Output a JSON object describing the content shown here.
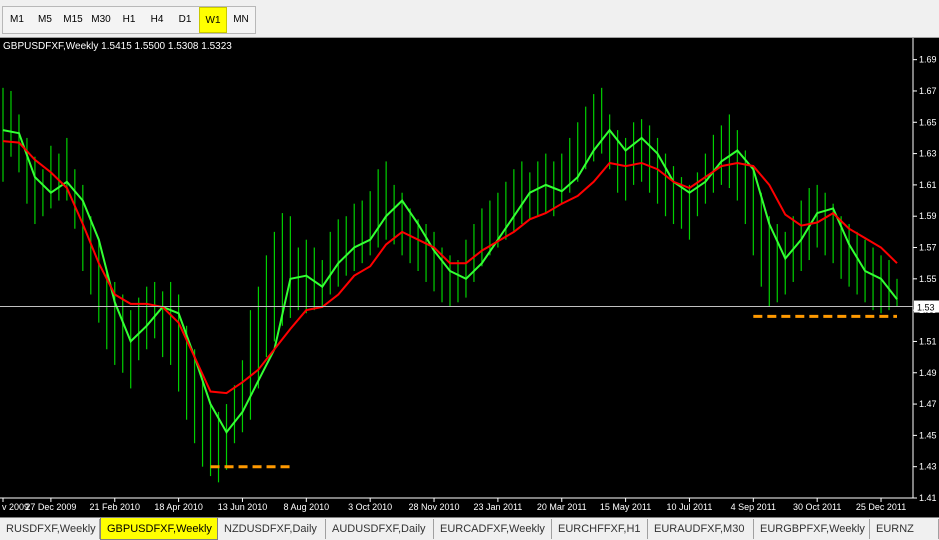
{
  "toolbar": {
    "timeframes": [
      {
        "label": "M1",
        "active": false
      },
      {
        "label": "M5",
        "active": false
      },
      {
        "label": "M15",
        "active": false
      },
      {
        "label": "M30",
        "active": false
      },
      {
        "label": "H1",
        "active": false
      },
      {
        "label": "H4",
        "active": false
      },
      {
        "label": "D1",
        "active": false
      },
      {
        "label": "W1",
        "active": true
      },
      {
        "label": "MN",
        "active": false
      }
    ]
  },
  "chart": {
    "header": "GBPUSDFXF,Weekly  1.5415 1.5500 1.5308 1.5323",
    "current_price_label": "1.53",
    "colors": {
      "background": "#000000",
      "bars": "#00d000",
      "fast_ma": "#33ff33",
      "slow_ma": "#ff0000",
      "support": "#ff9900",
      "axis": "#ffffff"
    }
  },
  "chart_data": {
    "type": "line",
    "title": "GBPUSDFXF,Weekly  1.5415 1.5500 1.5308 1.5323",
    "ylim": [
      1.41,
      1.7
    ],
    "y_ticks": [
      "1.69",
      "1.67",
      "1.65",
      "1.63",
      "1.61",
      "1.59",
      "1.57",
      "1.55",
      "1.53",
      "1.51",
      "1.49",
      "1.47",
      "1.45",
      "1.43",
      "1.41"
    ],
    "x_ticks": [
      {
        "week": 0,
        "label": "v 2009"
      },
      {
        "week": 6,
        "label": "27 Dec 2009"
      },
      {
        "week": 14,
        "label": "21 Feb 2010"
      },
      {
        "week": 22,
        "label": "18 Apr 2010"
      },
      {
        "week": 30,
        "label": "13 Jun 2010"
      },
      {
        "week": 38,
        "label": "8 Aug 2010"
      },
      {
        "week": 46,
        "label": "3 Oct 2010"
      },
      {
        "week": 54,
        "label": "28 Nov 2010"
      },
      {
        "week": 62,
        "label": "23 Jan 2011"
      },
      {
        "week": 70,
        "label": "20 Mar 2011"
      },
      {
        "week": 78,
        "label": "15 May 2011"
      },
      {
        "week": 86,
        "label": "10 Jul 2011"
      },
      {
        "week": 94,
        "label": "4 Sep 2011"
      },
      {
        "week": 102,
        "label": "30 Oct 2011"
      },
      {
        "week": 110,
        "label": "25 Dec 2011"
      }
    ],
    "weeks": 112,
    "series": [
      {
        "role": "fast_ma",
        "points": [
          [
            0,
            1.645
          ],
          [
            2,
            1.643
          ],
          [
            4,
            1.615
          ],
          [
            6,
            1.605
          ],
          [
            8,
            1.612
          ],
          [
            10,
            1.6
          ],
          [
            12,
            1.575
          ],
          [
            14,
            1.535
          ],
          [
            16,
            1.51
          ],
          [
            18,
            1.52
          ],
          [
            20,
            1.532
          ],
          [
            22,
            1.528
          ],
          [
            24,
            1.5
          ],
          [
            26,
            1.47
          ],
          [
            28,
            1.452
          ],
          [
            30,
            1.465
          ],
          [
            32,
            1.485
          ],
          [
            34,
            1.505
          ],
          [
            36,
            1.55
          ],
          [
            38,
            1.552
          ],
          [
            40,
            1.545
          ],
          [
            42,
            1.56
          ],
          [
            44,
            1.57
          ],
          [
            46,
            1.575
          ],
          [
            48,
            1.59
          ],
          [
            50,
            1.6
          ],
          [
            52,
            1.585
          ],
          [
            54,
            1.568
          ],
          [
            56,
            1.555
          ],
          [
            58,
            1.55
          ],
          [
            60,
            1.56
          ],
          [
            62,
            1.575
          ],
          [
            64,
            1.59
          ],
          [
            66,
            1.605
          ],
          [
            68,
            1.61
          ],
          [
            70,
            1.606
          ],
          [
            72,
            1.615
          ],
          [
            74,
            1.632
          ],
          [
            76,
            1.645
          ],
          [
            78,
            1.632
          ],
          [
            80,
            1.64
          ],
          [
            82,
            1.63
          ],
          [
            84,
            1.612
          ],
          [
            86,
            1.605
          ],
          [
            88,
            1.612
          ],
          [
            90,
            1.625
          ],
          [
            92,
            1.632
          ],
          [
            94,
            1.62
          ],
          [
            96,
            1.585
          ],
          [
            98,
            1.563
          ],
          [
            100,
            1.575
          ],
          [
            102,
            1.592
          ],
          [
            104,
            1.595
          ],
          [
            106,
            1.572
          ],
          [
            108,
            1.555
          ],
          [
            110,
            1.55
          ],
          [
            112,
            1.537
          ]
        ]
      },
      {
        "role": "slow_ma",
        "points": [
          [
            0,
            1.638
          ],
          [
            2,
            1.637
          ],
          [
            4,
            1.626
          ],
          [
            6,
            1.618
          ],
          [
            8,
            1.608
          ],
          [
            10,
            1.585
          ],
          [
            12,
            1.56
          ],
          [
            14,
            1.54
          ],
          [
            16,
            1.534
          ],
          [
            18,
            1.534
          ],
          [
            20,
            1.532
          ],
          [
            22,
            1.522
          ],
          [
            24,
            1.5
          ],
          [
            26,
            1.478
          ],
          [
            28,
            1.477
          ],
          [
            30,
            1.484
          ],
          [
            32,
            1.492
          ],
          [
            34,
            1.505
          ],
          [
            36,
            1.518
          ],
          [
            38,
            1.53
          ],
          [
            40,
            1.532
          ],
          [
            42,
            1.54
          ],
          [
            44,
            1.552
          ],
          [
            46,
            1.558
          ],
          [
            48,
            1.572
          ],
          [
            50,
            1.58
          ],
          [
            52,
            1.575
          ],
          [
            54,
            1.57
          ],
          [
            56,
            1.56
          ],
          [
            58,
            1.56
          ],
          [
            60,
            1.568
          ],
          [
            62,
            1.574
          ],
          [
            64,
            1.58
          ],
          [
            66,
            1.588
          ],
          [
            68,
            1.592
          ],
          [
            70,
            1.598
          ],
          [
            72,
            1.603
          ],
          [
            74,
            1.612
          ],
          [
            76,
            1.624
          ],
          [
            78,
            1.622
          ],
          [
            80,
            1.624
          ],
          [
            82,
            1.62
          ],
          [
            84,
            1.612
          ],
          [
            86,
            1.608
          ],
          [
            88,
            1.615
          ],
          [
            90,
            1.622
          ],
          [
            92,
            1.624
          ],
          [
            94,
            1.622
          ],
          [
            96,
            1.61
          ],
          [
            98,
            1.591
          ],
          [
            100,
            1.584
          ],
          [
            102,
            1.586
          ],
          [
            104,
            1.592
          ],
          [
            106,
            1.582
          ],
          [
            108,
            1.576
          ],
          [
            110,
            1.57
          ],
          [
            112,
            1.56
          ]
        ]
      }
    ],
    "bars": [
      [
        0,
        1.672,
        1.612
      ],
      [
        1,
        1.67,
        1.628
      ],
      [
        2,
        1.655,
        1.618
      ],
      [
        3,
        1.64,
        1.598
      ],
      [
        4,
        1.628,
        1.585
      ],
      [
        5,
        1.62,
        1.59
      ],
      [
        6,
        1.635,
        1.595
      ],
      [
        7,
        1.63,
        1.6
      ],
      [
        8,
        1.64,
        1.6
      ],
      [
        9,
        1.62,
        1.582
      ],
      [
        10,
        1.61,
        1.555
      ],
      [
        11,
        1.59,
        1.54
      ],
      [
        12,
        1.575,
        1.522
      ],
      [
        13,
        1.555,
        1.505
      ],
      [
        14,
        1.548,
        1.495
      ],
      [
        15,
        1.54,
        1.49
      ],
      [
        16,
        1.53,
        1.48
      ],
      [
        17,
        1.538,
        1.498
      ],
      [
        18,
        1.545,
        1.505
      ],
      [
        19,
        1.548,
        1.512
      ],
      [
        20,
        1.542,
        1.5
      ],
      [
        21,
        1.548,
        1.495
      ],
      [
        22,
        1.54,
        1.478
      ],
      [
        23,
        1.52,
        1.46
      ],
      [
        24,
        1.505,
        1.445
      ],
      [
        25,
        1.485,
        1.43
      ],
      [
        26,
        1.47,
        1.424
      ],
      [
        27,
        1.465,
        1.42
      ],
      [
        28,
        1.47,
        1.428
      ],
      [
        29,
        1.482,
        1.445
      ],
      [
        30,
        1.498,
        1.452
      ],
      [
        31,
        1.53,
        1.46
      ],
      [
        32,
        1.545,
        1.48
      ],
      [
        33,
        1.565,
        1.5
      ],
      [
        34,
        1.58,
        1.51
      ],
      [
        35,
        1.592,
        1.52
      ],
      [
        36,
        1.59,
        1.525
      ],
      [
        37,
        1.57,
        1.53
      ],
      [
        38,
        1.575,
        1.528
      ],
      [
        39,
        1.57,
        1.53
      ],
      [
        40,
        1.562,
        1.532
      ],
      [
        41,
        1.58,
        1.54
      ],
      [
        42,
        1.588,
        1.545
      ],
      [
        43,
        1.59,
        1.552
      ],
      [
        44,
        1.598,
        1.555
      ],
      [
        45,
        1.6,
        1.56
      ],
      [
        46,
        1.606,
        1.565
      ],
      [
        47,
        1.62,
        1.57
      ],
      [
        48,
        1.625,
        1.575
      ],
      [
        49,
        1.61,
        1.572
      ],
      [
        50,
        1.605,
        1.565
      ],
      [
        51,
        1.595,
        1.56
      ],
      [
        52,
        1.588,
        1.555
      ],
      [
        53,
        1.585,
        1.548
      ],
      [
        54,
        1.58,
        1.542
      ],
      [
        55,
        1.57,
        1.535
      ],
      [
        56,
        1.565,
        1.532
      ],
      [
        57,
        1.562,
        1.535
      ],
      [
        58,
        1.575,
        1.538
      ],
      [
        59,
        1.585,
        1.548
      ],
      [
        60,
        1.595,
        1.558
      ],
      [
        61,
        1.6,
        1.565
      ],
      [
        62,
        1.605,
        1.57
      ],
      [
        63,
        1.612,
        1.575
      ],
      [
        64,
        1.62,
        1.58
      ],
      [
        65,
        1.625,
        1.585
      ],
      [
        66,
        1.618,
        1.588
      ],
      [
        67,
        1.625,
        1.59
      ],
      [
        68,
        1.63,
        1.592
      ],
      [
        69,
        1.625,
        1.59
      ],
      [
        70,
        1.63,
        1.598
      ],
      [
        71,
        1.64,
        1.605
      ],
      [
        72,
        1.65,
        1.612
      ],
      [
        73,
        1.66,
        1.62
      ],
      [
        74,
        1.668,
        1.625
      ],
      [
        75,
        1.672,
        1.63
      ],
      [
        76,
        1.655,
        1.62
      ],
      [
        77,
        1.645,
        1.605
      ],
      [
        78,
        1.64,
        1.6
      ],
      [
        79,
        1.65,
        1.61
      ],
      [
        80,
        1.652,
        1.612
      ],
      [
        81,
        1.648,
        1.605
      ],
      [
        82,
        1.64,
        1.598
      ],
      [
        83,
        1.63,
        1.59
      ],
      [
        84,
        1.622,
        1.585
      ],
      [
        85,
        1.615,
        1.582
      ],
      [
        86,
        1.61,
        1.575
      ],
      [
        87,
        1.618,
        1.59
      ],
      [
        88,
        1.63,
        1.598
      ],
      [
        89,
        1.642,
        1.605
      ],
      [
        90,
        1.648,
        1.61
      ],
      [
        91,
        1.655,
        1.608
      ],
      [
        92,
        1.645,
        1.6
      ],
      [
        93,
        1.632,
        1.585
      ],
      [
        94,
        1.62,
        1.565
      ],
      [
        95,
        1.605,
        1.545
      ],
      [
        96,
        1.59,
        1.532
      ],
      [
        97,
        1.585,
        1.535
      ],
      [
        98,
        1.58,
        1.54
      ],
      [
        99,
        1.59,
        1.548
      ],
      [
        100,
        1.6,
        1.555
      ],
      [
        101,
        1.608,
        1.562
      ],
      [
        102,
        1.61,
        1.57
      ],
      [
        103,
        1.605,
        1.565
      ],
      [
        104,
        1.598,
        1.56
      ],
      [
        105,
        1.59,
        1.55
      ],
      [
        106,
        1.585,
        1.545
      ],
      [
        107,
        1.58,
        1.54
      ],
      [
        108,
        1.575,
        1.535
      ],
      [
        109,
        1.57,
        1.53
      ],
      [
        110,
        1.565,
        1.528
      ],
      [
        111,
        1.562,
        1.53
      ],
      [
        112,
        1.55,
        1.532
      ]
    ],
    "current_price": 1.5323,
    "support_lines": [
      {
        "from_week": 26,
        "to_week": 36,
        "level": 1.43
      },
      {
        "from_week": 94,
        "to_week": 112,
        "level": 1.526
      }
    ]
  },
  "symbol_tabs": [
    {
      "label": "RUSDFXF,Weekly",
      "active": false
    },
    {
      "label": "GBPUSDFXF,Weekly",
      "active": true
    },
    {
      "label": "NZDUSDFXF,Daily",
      "active": false
    },
    {
      "label": "AUDUSDFXF,Daily",
      "active": false
    },
    {
      "label": "EURCADFXF,Weekly",
      "active": false
    },
    {
      "label": "EURCHFFXF,H1",
      "active": false
    },
    {
      "label": "EURAUDFXF,M30",
      "active": false
    },
    {
      "label": "EURGBPFXF,Weekly",
      "active": false
    },
    {
      "label": "EURNZ",
      "active": false
    }
  ]
}
